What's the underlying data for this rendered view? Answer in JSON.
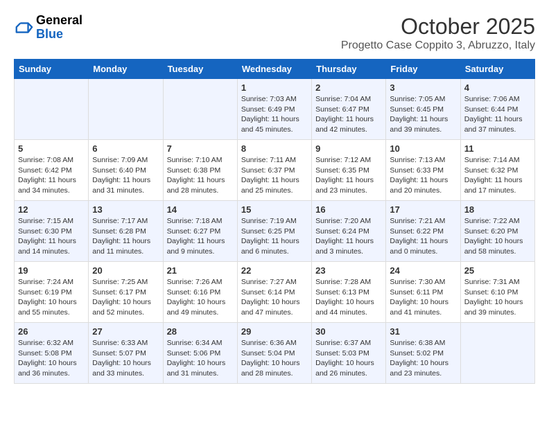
{
  "header": {
    "logo_general": "General",
    "logo_blue": "Blue",
    "month_title": "October 2025",
    "subtitle": "Progetto Case Coppito 3, Abruzzo, Italy"
  },
  "days_of_week": [
    "Sunday",
    "Monday",
    "Tuesday",
    "Wednesday",
    "Thursday",
    "Friday",
    "Saturday"
  ],
  "weeks": [
    [
      {
        "day": "",
        "info": ""
      },
      {
        "day": "",
        "info": ""
      },
      {
        "day": "",
        "info": ""
      },
      {
        "day": "1",
        "info": "Sunrise: 7:03 AM\nSunset: 6:49 PM\nDaylight: 11 hours and 45 minutes."
      },
      {
        "day": "2",
        "info": "Sunrise: 7:04 AM\nSunset: 6:47 PM\nDaylight: 11 hours and 42 minutes."
      },
      {
        "day": "3",
        "info": "Sunrise: 7:05 AM\nSunset: 6:45 PM\nDaylight: 11 hours and 39 minutes."
      },
      {
        "day": "4",
        "info": "Sunrise: 7:06 AM\nSunset: 6:44 PM\nDaylight: 11 hours and 37 minutes."
      }
    ],
    [
      {
        "day": "5",
        "info": "Sunrise: 7:08 AM\nSunset: 6:42 PM\nDaylight: 11 hours and 34 minutes."
      },
      {
        "day": "6",
        "info": "Sunrise: 7:09 AM\nSunset: 6:40 PM\nDaylight: 11 hours and 31 minutes."
      },
      {
        "day": "7",
        "info": "Sunrise: 7:10 AM\nSunset: 6:38 PM\nDaylight: 11 hours and 28 minutes."
      },
      {
        "day": "8",
        "info": "Sunrise: 7:11 AM\nSunset: 6:37 PM\nDaylight: 11 hours and 25 minutes."
      },
      {
        "day": "9",
        "info": "Sunrise: 7:12 AM\nSunset: 6:35 PM\nDaylight: 11 hours and 23 minutes."
      },
      {
        "day": "10",
        "info": "Sunrise: 7:13 AM\nSunset: 6:33 PM\nDaylight: 11 hours and 20 minutes."
      },
      {
        "day": "11",
        "info": "Sunrise: 7:14 AM\nSunset: 6:32 PM\nDaylight: 11 hours and 17 minutes."
      }
    ],
    [
      {
        "day": "12",
        "info": "Sunrise: 7:15 AM\nSunset: 6:30 PM\nDaylight: 11 hours and 14 minutes."
      },
      {
        "day": "13",
        "info": "Sunrise: 7:17 AM\nSunset: 6:28 PM\nDaylight: 11 hours and 11 minutes."
      },
      {
        "day": "14",
        "info": "Sunrise: 7:18 AM\nSunset: 6:27 PM\nDaylight: 11 hours and 9 minutes."
      },
      {
        "day": "15",
        "info": "Sunrise: 7:19 AM\nSunset: 6:25 PM\nDaylight: 11 hours and 6 minutes."
      },
      {
        "day": "16",
        "info": "Sunrise: 7:20 AM\nSunset: 6:24 PM\nDaylight: 11 hours and 3 minutes."
      },
      {
        "day": "17",
        "info": "Sunrise: 7:21 AM\nSunset: 6:22 PM\nDaylight: 11 hours and 0 minutes."
      },
      {
        "day": "18",
        "info": "Sunrise: 7:22 AM\nSunset: 6:20 PM\nDaylight: 10 hours and 58 minutes."
      }
    ],
    [
      {
        "day": "19",
        "info": "Sunrise: 7:24 AM\nSunset: 6:19 PM\nDaylight: 10 hours and 55 minutes."
      },
      {
        "day": "20",
        "info": "Sunrise: 7:25 AM\nSunset: 6:17 PM\nDaylight: 10 hours and 52 minutes."
      },
      {
        "day": "21",
        "info": "Sunrise: 7:26 AM\nSunset: 6:16 PM\nDaylight: 10 hours and 49 minutes."
      },
      {
        "day": "22",
        "info": "Sunrise: 7:27 AM\nSunset: 6:14 PM\nDaylight: 10 hours and 47 minutes."
      },
      {
        "day": "23",
        "info": "Sunrise: 7:28 AM\nSunset: 6:13 PM\nDaylight: 10 hours and 44 minutes."
      },
      {
        "day": "24",
        "info": "Sunrise: 7:30 AM\nSunset: 6:11 PM\nDaylight: 10 hours and 41 minutes."
      },
      {
        "day": "25",
        "info": "Sunrise: 7:31 AM\nSunset: 6:10 PM\nDaylight: 10 hours and 39 minutes."
      }
    ],
    [
      {
        "day": "26",
        "info": "Sunrise: 6:32 AM\nSunset: 5:08 PM\nDaylight: 10 hours and 36 minutes."
      },
      {
        "day": "27",
        "info": "Sunrise: 6:33 AM\nSunset: 5:07 PM\nDaylight: 10 hours and 33 minutes."
      },
      {
        "day": "28",
        "info": "Sunrise: 6:34 AM\nSunset: 5:06 PM\nDaylight: 10 hours and 31 minutes."
      },
      {
        "day": "29",
        "info": "Sunrise: 6:36 AM\nSunset: 5:04 PM\nDaylight: 10 hours and 28 minutes."
      },
      {
        "day": "30",
        "info": "Sunrise: 6:37 AM\nSunset: 5:03 PM\nDaylight: 10 hours and 26 minutes."
      },
      {
        "day": "31",
        "info": "Sunrise: 6:38 AM\nSunset: 5:02 PM\nDaylight: 10 hours and 23 minutes."
      },
      {
        "day": "",
        "info": ""
      }
    ]
  ]
}
